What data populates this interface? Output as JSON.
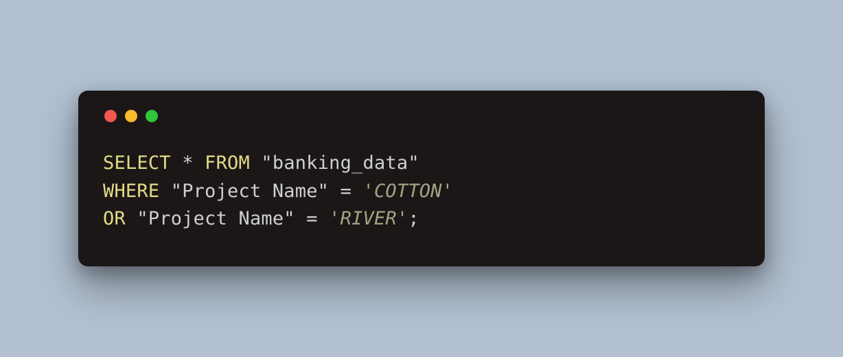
{
  "code": {
    "line1": {
      "kw1": "SELECT",
      "star": " * ",
      "kw2": "FROM",
      "sp": " ",
      "tbl": "\"banking_data\""
    },
    "line2": {
      "kw1": "WHERE",
      "sp": " ",
      "col": "\"Project Name\"",
      "eq": " = ",
      "val": "'COTTON'"
    },
    "line3": {
      "kw1": "OR",
      "sp": " ",
      "col": "\"Project Name\"",
      "eq": " = ",
      "val": "'RIVER'",
      "semi": ";"
    }
  }
}
